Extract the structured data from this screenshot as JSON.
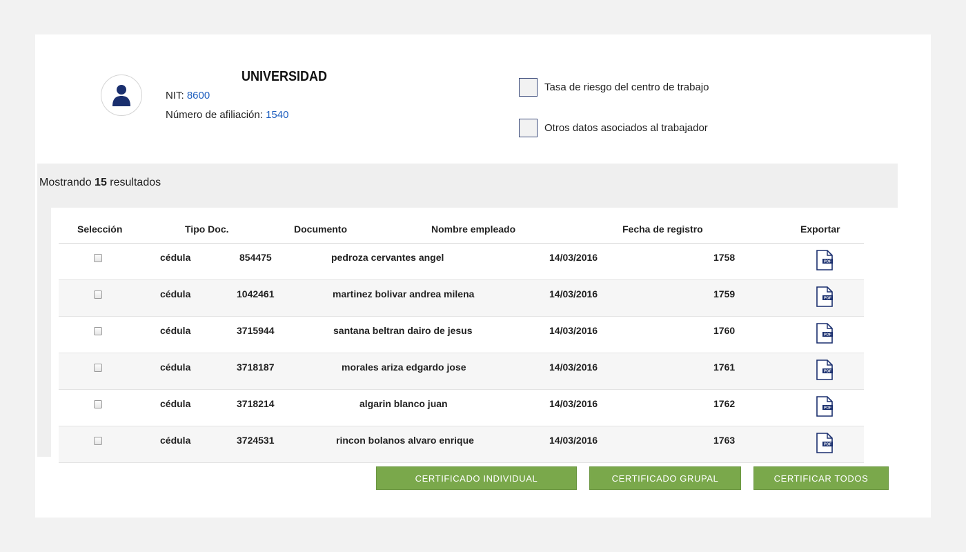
{
  "company": {
    "name": "UNIVERSIDAD",
    "nit_label": "NIT:",
    "nit_value": "8600",
    "afiliacion_label": "Número de afiliación:",
    "afiliacion_value": "1540"
  },
  "options": [
    {
      "label": "Tasa de riesgo del centro de trabajo",
      "checked": false
    },
    {
      "label": "Otros datos asociados al trabajador",
      "checked": false
    }
  ],
  "results": {
    "prefix": "Mostrando",
    "count": "15",
    "suffix": "resultados"
  },
  "table": {
    "headers": [
      "Selección",
      "Tipo Doc.",
      "Documento",
      "Nombre empleado",
      "Fecha de registro",
      "Exportar"
    ],
    "rows": [
      {
        "tipo": "cédula",
        "documento": "854475",
        "nombre": "pedroza cervantes angel",
        "fecha": "14/03/2016",
        "numero": "1758"
      },
      {
        "tipo": "cédula",
        "documento": "1042461",
        "nombre": "martinez bolivar andrea milena",
        "fecha": "14/03/2016",
        "numero": "1759"
      },
      {
        "tipo": "cédula",
        "documento": "3715944",
        "nombre": "santana beltran dairo de jesus",
        "fecha": "14/03/2016",
        "numero": "1760"
      },
      {
        "tipo": "cédula",
        "documento": "3718187",
        "nombre": "morales ariza edgardo jose",
        "fecha": "14/03/2016",
        "numero": "1761"
      },
      {
        "tipo": "cédula",
        "documento": "3718214",
        "nombre": "algarin blanco juan",
        "fecha": "14/03/2016",
        "numero": "1762"
      },
      {
        "tipo": "cédula",
        "documento": "3724531",
        "nombre": "rincon bolanos alvaro enrique",
        "fecha": "14/03/2016",
        "numero": "1763"
      }
    ]
  },
  "icons": {
    "avatar": "user-icon",
    "export": "pdf-icon",
    "pdf_text": "PDF"
  },
  "buttons": {
    "individual": "CERTIFICADO INDIVIDUAL",
    "grupal": "CERTIFICADO GRUPAL",
    "todos": "CERTIFICAR TODOS"
  },
  "colors": {
    "accent_link": "#1f5fbf",
    "button_green": "#7aa84b",
    "icon_navy": "#1a2f6e"
  }
}
